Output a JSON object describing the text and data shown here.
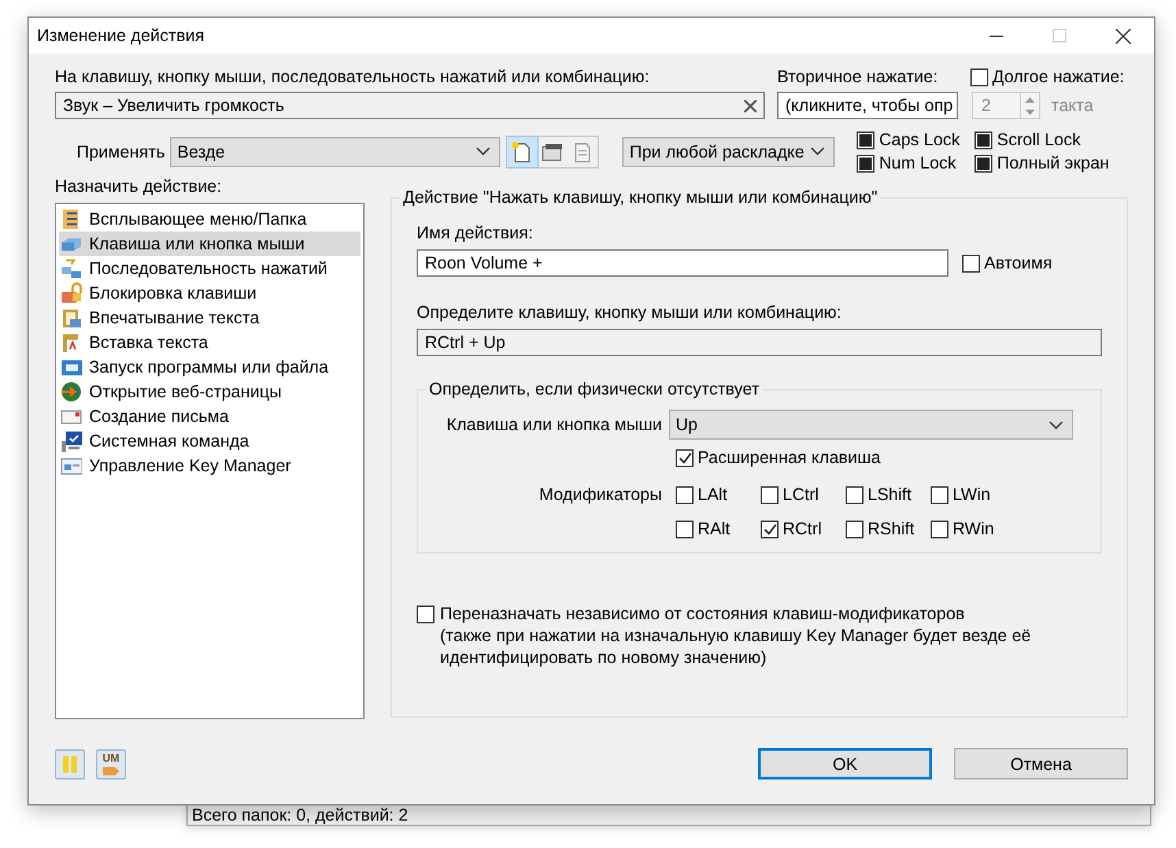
{
  "window": {
    "title": "Изменение действия"
  },
  "trigger": {
    "label": "На клавишу, кнопку мыши, последовательность нажатий или комбинацию:",
    "value": "Звук – Увеличить громкость"
  },
  "secondary": {
    "label": "Вторичное нажатие:",
    "value": "(кликните, чтобы опр"
  },
  "long_press": {
    "label": "Долгое нажатие:",
    "checked": false,
    "count": "2",
    "unit": "такта"
  },
  "apply": {
    "label": "Применять",
    "value": "Везде"
  },
  "layout_combo": {
    "value": "При любой раскладке"
  },
  "toggles": [
    {
      "label": "Caps Lock",
      "indeterminate": true
    },
    {
      "label": "Scroll Lock",
      "indeterminate": true
    },
    {
      "label": "Num Lock",
      "indeterminate": true
    },
    {
      "label": "Полный экран",
      "indeterminate": true
    }
  ],
  "actions": {
    "label": "Назначить действие:",
    "items": [
      {
        "label": "Всплывающее меню/Папка",
        "selected": false
      },
      {
        "label": "Клавиша или кнопка мыши",
        "selected": true
      },
      {
        "label": "Последовательность нажатий",
        "selected": false
      },
      {
        "label": "Блокировка клавиши",
        "selected": false
      },
      {
        "label": "Впечатывание текста",
        "selected": false
      },
      {
        "label": "Вставка текста",
        "selected": false
      },
      {
        "label": "Запуск программы или файла",
        "selected": false
      },
      {
        "label": "Открытие веб-страницы",
        "selected": false
      },
      {
        "label": "Создание письма",
        "selected": false
      },
      {
        "label": "Системная команда",
        "selected": false
      },
      {
        "label": "Управление Key Manager",
        "selected": false
      }
    ]
  },
  "group": {
    "title": "Действие \"Нажать клавишу, кнопку мыши или комбинацию\"",
    "name_label": "Имя действия:",
    "name_value": "Roon Volume +",
    "autoname": {
      "label": "Автоимя",
      "checked": false
    },
    "combo_label": "Определите клавишу, кнопку мыши или комбинацию:",
    "combo_value": "RCtrl + Up",
    "physical": {
      "title": "Определить, если физически отсутствует",
      "key_label": "Клавиша или кнопка мыши",
      "key_value": "Up",
      "extended": {
        "label": "Расширенная клавиша",
        "checked": true
      },
      "modifiers_label": "Модификаторы",
      "modifiers": [
        {
          "label": "LAlt",
          "checked": false
        },
        {
          "label": "LCtrl",
          "checked": false
        },
        {
          "label": "LShift",
          "checked": false
        },
        {
          "label": "LWin",
          "checked": false
        },
        {
          "label": "RAlt",
          "checked": false
        },
        {
          "label": "RCtrl",
          "checked": true
        },
        {
          "label": "RShift",
          "checked": false
        },
        {
          "label": "RWin",
          "checked": false
        }
      ]
    },
    "remap": {
      "checked": false,
      "label": "Переназначать независимо от состояния клавиш-модификаторов",
      "note": "(также при нажатии на изначальную клавишу Key Manager будет везде её идентифицировать по новому значению)"
    }
  },
  "buttons": [
    {
      "label": "OK",
      "default": true
    },
    {
      "label": "Отмена",
      "default": false
    }
  ],
  "um_badge": "UM",
  "background_status": "Всего папок: 0, действий: 2"
}
